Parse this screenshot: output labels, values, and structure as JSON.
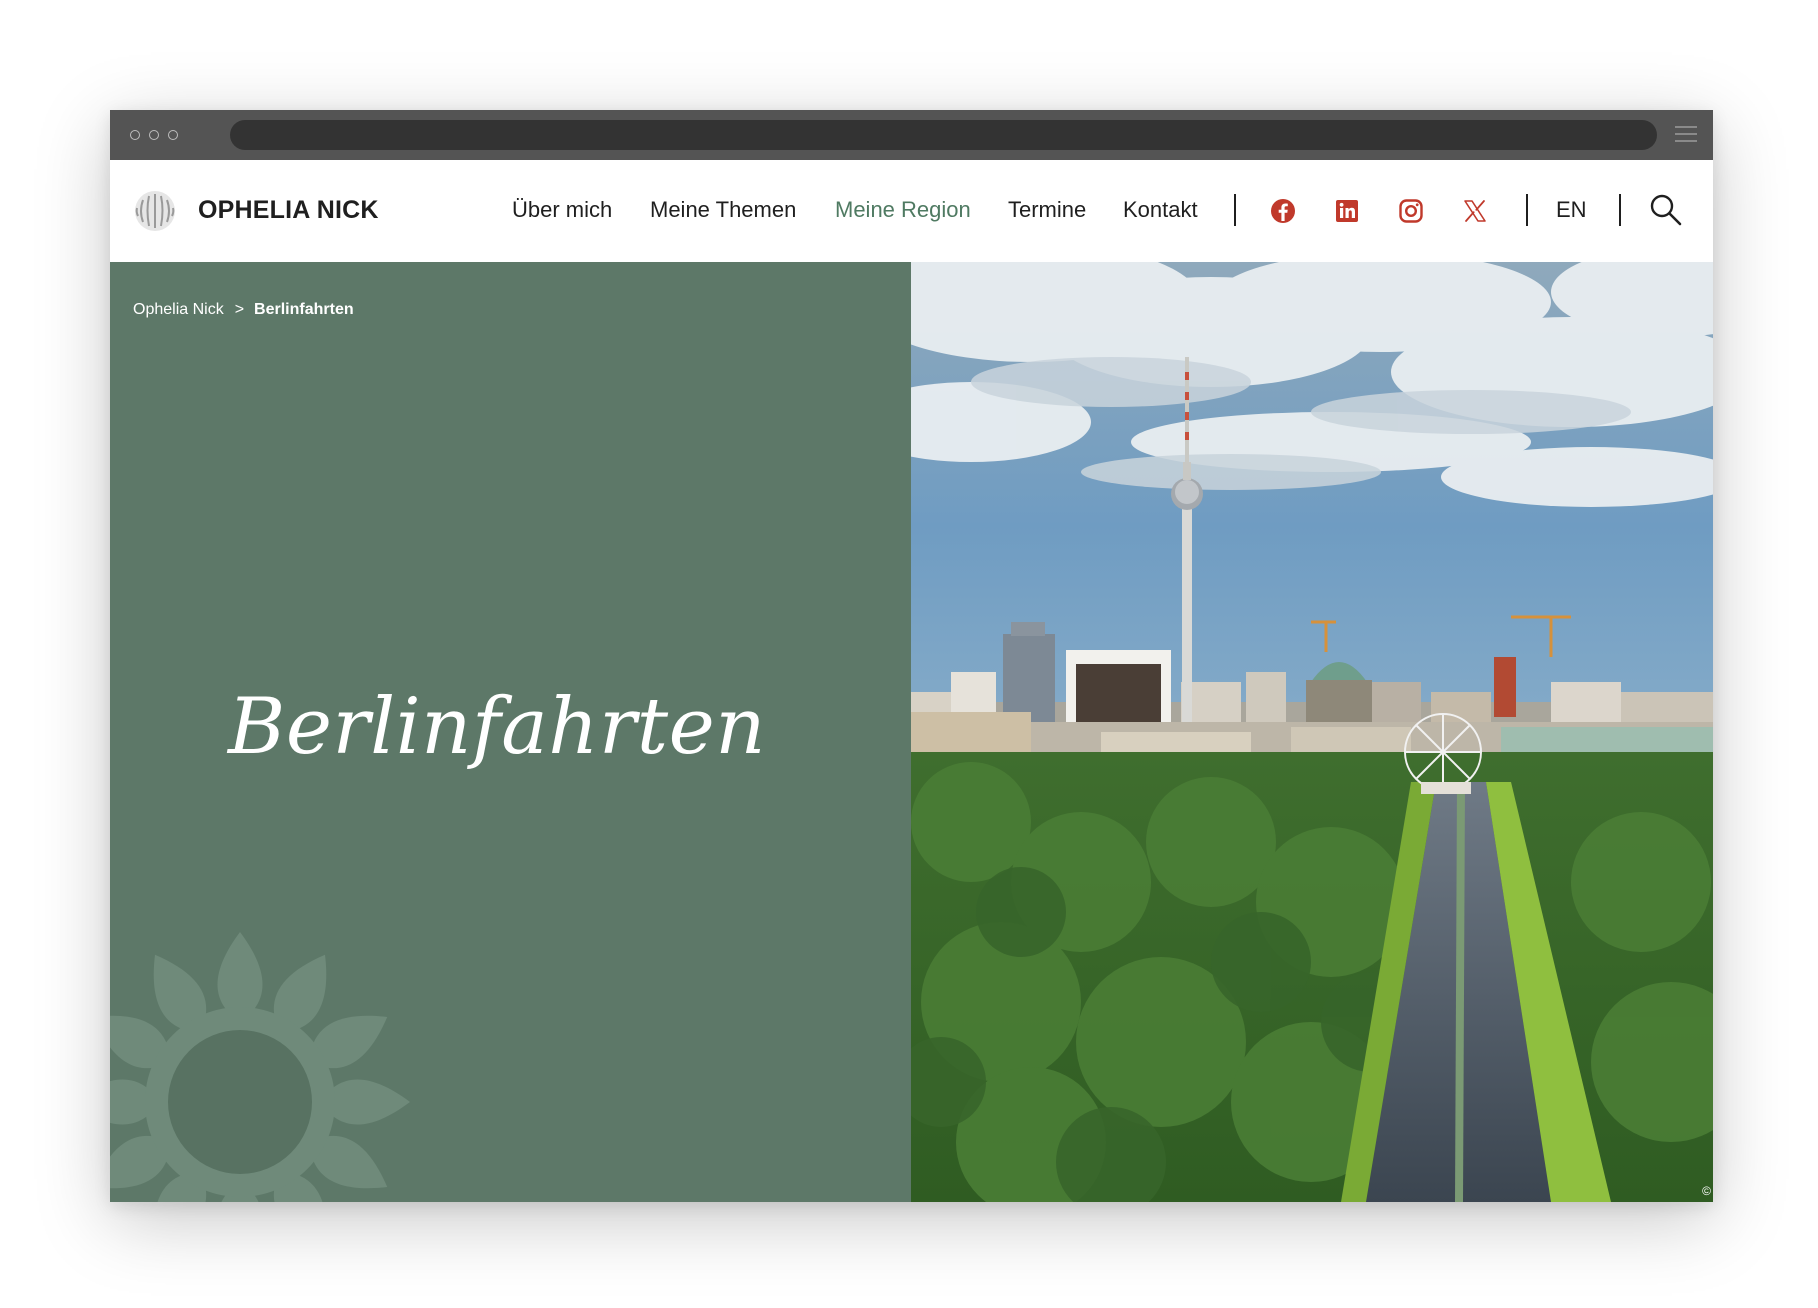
{
  "site": {
    "name": "OPHELIA NICK"
  },
  "nav": {
    "items": [
      {
        "label": "Über mich"
      },
      {
        "label": "Meine Themen"
      },
      {
        "label": "Meine Region",
        "active": true
      },
      {
        "label": "Termine"
      },
      {
        "label": "Kontakt"
      }
    ]
  },
  "social": [
    "facebook-icon",
    "linkedin-icon",
    "instagram-icon",
    "x-icon"
  ],
  "language": {
    "label": "EN"
  },
  "breadcrumb": {
    "home": "Ophelia Nick",
    "separator": ">",
    "current": "Berlinfahrten"
  },
  "hero": {
    "title": "Berlinfahrten",
    "copyright": "©"
  },
  "colors": {
    "hero_green": "#5d7868",
    "active_nav": "#4f7a62",
    "social_red": "#c0392b",
    "chrome": "#545454"
  }
}
